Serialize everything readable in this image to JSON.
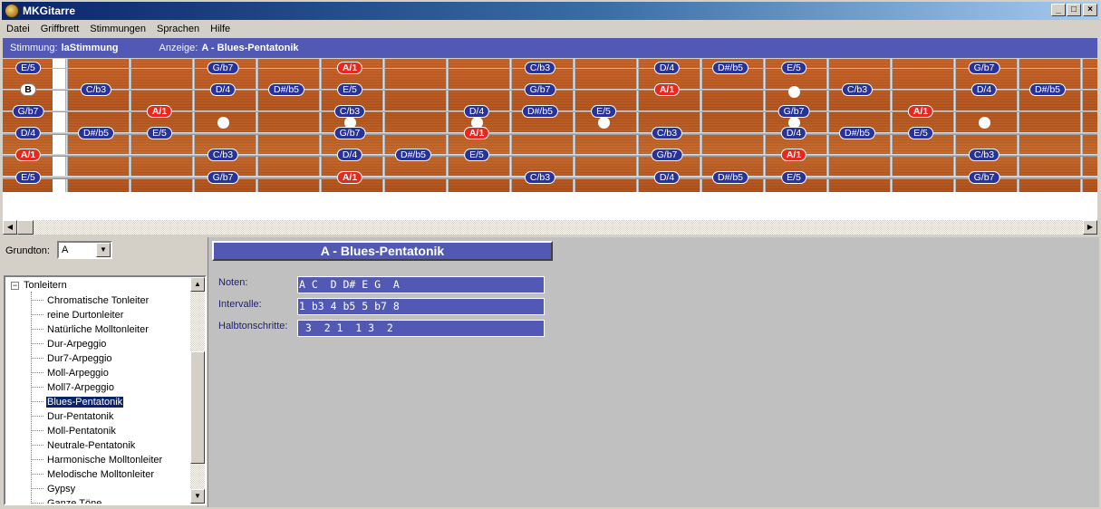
{
  "window": {
    "title": "MKGitarre",
    "min": "_",
    "max": "□",
    "close": "×"
  },
  "menu": [
    "Datei",
    "Griffbrett",
    "Stimmungen",
    "Sprachen",
    "Hilfe"
  ],
  "info": {
    "stimmung_label": "Stimmung:",
    "stimmung_value": "laStimmung",
    "anzeige_label": "Anzeige:",
    "anzeige_value": "A - Blues-Pentatonik"
  },
  "fretboard": {
    "open_string_b": "B",
    "notes": [
      {
        "label": "E/5",
        "root": false
      },
      {
        "label": "G/b7",
        "root": false
      },
      {
        "label": "A/1",
        "root": true
      },
      {
        "label": "C/b3",
        "root": false
      },
      {
        "label": "D/4",
        "root": false
      },
      {
        "label": "D#/b5",
        "root": false
      },
      {
        "label": "E/5",
        "root": false
      },
      {
        "label": "G/b7",
        "root": false
      },
      {
        "label": "C/b3",
        "root": false
      },
      {
        "label": "D/4",
        "root": false
      },
      {
        "label": "D#/b5",
        "root": false
      },
      {
        "label": "E/5",
        "root": false
      },
      {
        "label": "G/b7",
        "root": false
      },
      {
        "label": "A/1",
        "root": true
      },
      {
        "label": "C/b3",
        "root": false
      },
      {
        "label": "D/4",
        "root": false
      },
      {
        "label": "D#/b5",
        "root": false
      },
      {
        "label": "G/b7",
        "root": false
      },
      {
        "label": "A/1",
        "root": true
      },
      {
        "label": "C/b3",
        "root": false
      },
      {
        "label": "D/4",
        "root": false
      },
      {
        "label": "D#/b5",
        "root": false
      },
      {
        "label": "E/5",
        "root": false
      },
      {
        "label": "G/b7",
        "root": false
      },
      {
        "label": "A/1",
        "root": true
      },
      {
        "label": "D/4",
        "root": false
      },
      {
        "label": "D#/b5",
        "root": false
      },
      {
        "label": "E/5",
        "root": false
      },
      {
        "label": "G/b7",
        "root": false
      },
      {
        "label": "A/1",
        "root": true
      },
      {
        "label": "C/b3",
        "root": false
      },
      {
        "label": "D/4",
        "root": false
      },
      {
        "label": "D#/b5",
        "root": false
      },
      {
        "label": "E/5",
        "root": false
      },
      {
        "label": "A/1",
        "root": true
      },
      {
        "label": "C/b3",
        "root": false
      },
      {
        "label": "D/4",
        "root": false
      },
      {
        "label": "D#/b5",
        "root": false
      },
      {
        "label": "E/5",
        "root": false
      },
      {
        "label": "G/b7",
        "root": false
      },
      {
        "label": "A/1",
        "root": true
      },
      {
        "label": "C/b3",
        "root": false
      },
      {
        "label": "E/5",
        "root": false
      },
      {
        "label": "G/b7",
        "root": false
      },
      {
        "label": "A/1",
        "root": true
      },
      {
        "label": "C/b3",
        "root": false
      },
      {
        "label": "D/4",
        "root": false
      },
      {
        "label": "D#/b5",
        "root": false
      },
      {
        "label": "E/5",
        "root": false
      },
      {
        "label": "G/b7",
        "root": false
      }
    ]
  },
  "left": {
    "grundton_label": "Grundton:",
    "grundton_value": "A",
    "tree_root": "Tonleitern",
    "tree_items": [
      "Chromatische Tonleiter",
      "reine Durtonleiter",
      "Natürliche Molltonleiter",
      "Dur-Arpeggio",
      "Dur7-Arpeggio",
      "Moll-Arpeggio",
      "Moll7-Arpeggio",
      "Blues-Pentatonik",
      "Dur-Pentatonik",
      "Moll-Pentatonik",
      "Neutrale-Pentatonik",
      "Harmonische Molltonleiter",
      "Melodische Molltonleiter",
      "Gypsy",
      "Ganze Töne"
    ],
    "selected_item": "Blues-Pentatonik"
  },
  "detail": {
    "title": "A - Blues-Pentatonik",
    "noten_label": "Noten:",
    "noten_value": "A C  D D# E G  A",
    "intervalle_label": "Intervalle:",
    "intervalle_value": "1 b3 4 b5 5 b7 8",
    "halbton_label": "Halbtonschritte:",
    "halbton_value": " 3  2 1  1 3  2"
  },
  "colors": {
    "note_bg": "#283399",
    "root_bg": "#e32a1c",
    "panel_blue": "#5159b4",
    "wood": "#c0612a"
  }
}
